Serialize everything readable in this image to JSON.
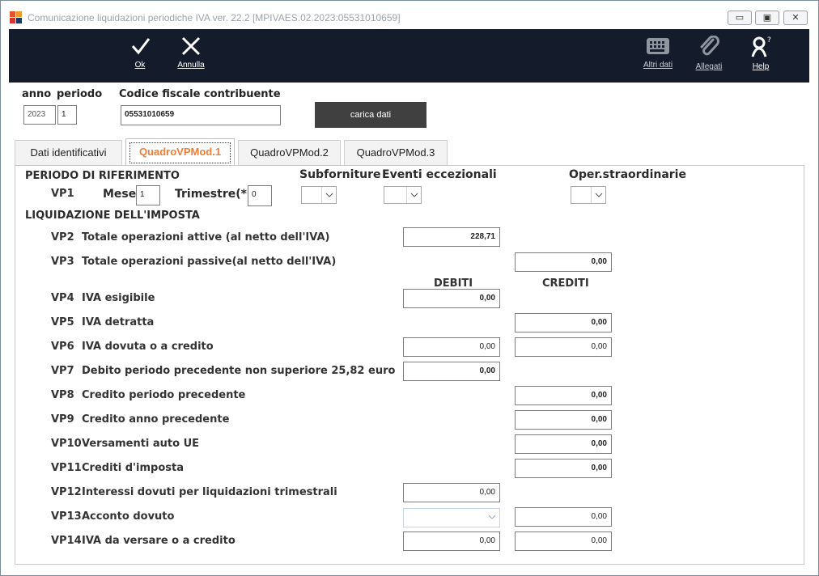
{
  "window": {
    "title": "Comunicazione liquidazioni periodiche IVA  ver. 22.2  [MPIVAES.02.2023:05531010659]",
    "min_label": "▭",
    "max_label": "▣",
    "close_label": "✕"
  },
  "toolbar": {
    "ok_label": "Ok",
    "cancel_label": "Annulla",
    "other_label": "Altri dati",
    "attach_label": "Allegati",
    "help_label": "Help"
  },
  "header": {
    "anno_label": "anno",
    "periodo_label": "periodo",
    "cf_label": "Codice fiscale contribuente",
    "anno_value": "2023",
    "periodo_value": "1",
    "cf_value": "05531010659",
    "load_label": "carica dati"
  },
  "tabs": [
    {
      "label": "Dati identificativi"
    },
    {
      "label": "QuadroVPMod.1"
    },
    {
      "label": "QuadroVPMod.2"
    },
    {
      "label": "QuadroVPMod.3"
    }
  ],
  "period": {
    "title": "PERIODO DI RIFERIMENTO",
    "code": "VP1",
    "mese_label": "Mese",
    "mese_value": "1",
    "trimestre_label": "Trimestre(*)",
    "trimestre_value": "0",
    "subforniture_label": "Subforniture",
    "eventi_label": "Eventi eccezionali",
    "oper_label": "Oper.straordinarie"
  },
  "liquidation": {
    "title": "LIQUIDAZIONE DELL'IMPOSTA",
    "debiti_label": "DEBITI",
    "crediti_label": "CREDITI",
    "rows": [
      {
        "code": "VP2",
        "desc": "Totale operazioni attive (al netto dell'IVA)",
        "debit": "228,71"
      },
      {
        "code": "VP3",
        "desc": "Totale operazioni passive(al netto dell'IVA)",
        "credit": "0,00"
      },
      {
        "code": "VP4",
        "desc": "IVA esigibile",
        "debit": "0,00"
      },
      {
        "code": "VP5",
        "desc": "IVA detratta",
        "credit": "0,00"
      },
      {
        "code": "VP6",
        "desc": "IVA dovuta o a credito",
        "debit": "0,00",
        "credit": "0,00"
      },
      {
        "code": "VP7",
        "desc": "Debito periodo precedente non superiore 25,82 euro",
        "debit": "0,00"
      },
      {
        "code": "VP8",
        "desc": "Credito periodo precedente",
        "credit": "0,00"
      },
      {
        "code": "VP9",
        "desc": "Credito anno precedente",
        "credit": "0,00"
      },
      {
        "code": "VP10",
        "desc": "Versamenti auto UE",
        "credit": "0,00"
      },
      {
        "code": "VP11",
        "desc": "Crediti d'imposta",
        "credit": "0,00"
      },
      {
        "code": "VP12",
        "desc": "Interessi dovuti per liquidazioni trimestrali",
        "debit": "0,00"
      },
      {
        "code": "VP13",
        "desc": "Acconto dovuto",
        "credit": "0,00"
      },
      {
        "code": "VP14",
        "desc": "IVA da versare o a credito",
        "debit": "0,00",
        "credit": "0,00"
      }
    ]
  }
}
